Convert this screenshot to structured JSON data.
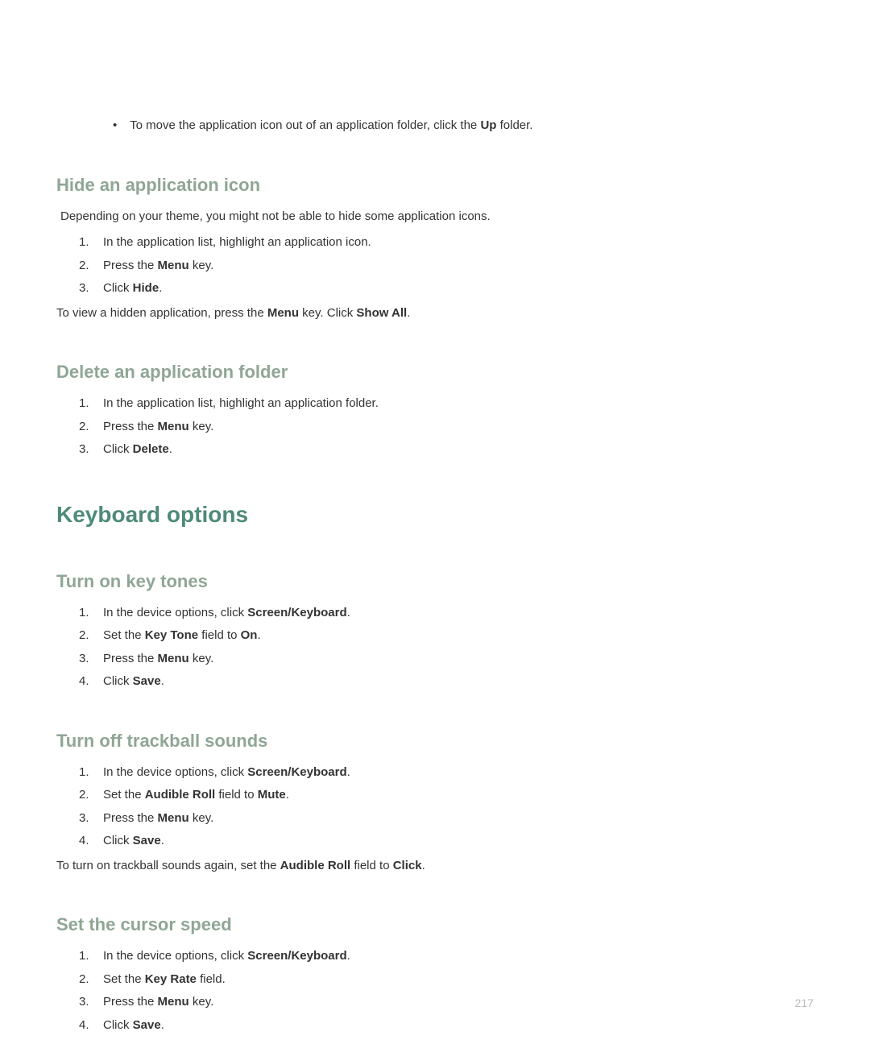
{
  "bullet1": {
    "prefix": "To move the application icon out of an application folder, click the ",
    "bold": "Up",
    "suffix": " folder."
  },
  "section_hide": {
    "heading": "Hide an application icon",
    "intro": "Depending on your theme, you might not be able to hide some application icons.",
    "item1": "In the application list, highlight an application icon.",
    "item2_prefix": "Press the ",
    "item2_bold": "Menu",
    "item2_suffix": " key.",
    "item3_prefix": "Click ",
    "item3_bold": "Hide",
    "item3_suffix": ".",
    "followup_prefix": "To view a hidden application, press the ",
    "followup_bold1": "Menu",
    "followup_mid": " key. Click ",
    "followup_bold2": "Show All",
    "followup_suffix": "."
  },
  "section_delete": {
    "heading": "Delete an application folder",
    "item1": "In the application list, highlight an application folder.",
    "item2_prefix": "Press the ",
    "item2_bold": "Menu",
    "item2_suffix": " key.",
    "item3_prefix": "Click ",
    "item3_bold": "Delete",
    "item3_suffix": "."
  },
  "main_heading": "Keyboard options",
  "section_keytones": {
    "heading": "Turn on key tones",
    "item1_prefix": "In the device options, click ",
    "item1_bold": "Screen/Keyboard",
    "item1_suffix": ".",
    "item2_prefix": "Set the ",
    "item2_bold1": "Key Tone",
    "item2_mid": " field to ",
    "item2_bold2": "On",
    "item2_suffix": ".",
    "item3_prefix": "Press the ",
    "item3_bold": "Menu",
    "item3_suffix": " key.",
    "item4_prefix": "Click ",
    "item4_bold": "Save",
    "item4_suffix": "."
  },
  "section_trackball": {
    "heading": "Turn off trackball sounds",
    "item1_prefix": "In the device options, click ",
    "item1_bold": "Screen/Keyboard",
    "item1_suffix": ".",
    "item2_prefix": "Set the ",
    "item2_bold1": "Audible Roll",
    "item2_mid": " field to ",
    "item2_bold2": "Mute",
    "item2_suffix": ".",
    "item3_prefix": "Press the ",
    "item3_bold": "Menu",
    "item3_suffix": " key.",
    "item4_prefix": "Click ",
    "item4_bold": "Save",
    "item4_suffix": ".",
    "followup_prefix": "To turn on trackball sounds again, set the ",
    "followup_bold1": "Audible Roll",
    "followup_mid": " field to ",
    "followup_bold2": "Click",
    "followup_suffix": "."
  },
  "section_cursor": {
    "heading": "Set the cursor speed",
    "item1_prefix": "In the device options, click ",
    "item1_bold": "Screen/Keyboard",
    "item1_suffix": ".",
    "item2_prefix": "Set the ",
    "item2_bold": "Key Rate",
    "item2_suffix": " field.",
    "item3_prefix": "Press the ",
    "item3_bold": "Menu",
    "item3_suffix": " key.",
    "item4_prefix": "Click ",
    "item4_bold": "Save",
    "item4_suffix": "."
  },
  "page_number": "217"
}
